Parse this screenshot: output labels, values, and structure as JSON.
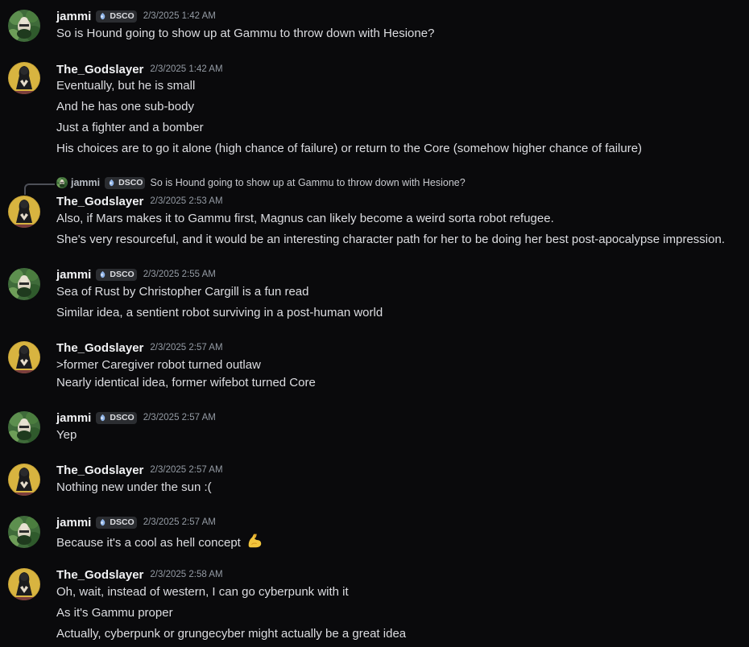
{
  "colors": {
    "background": "#0a0a0c",
    "text": "#dcdde1",
    "username": "#f2f3f5",
    "timestamp": "#949ba4",
    "tag_bg": "#2b2d31"
  },
  "messages": [
    {
      "user": "jammi",
      "avatar": "jammi-avatar",
      "tag": "DSCO",
      "timestamp": "2/3/2025 1:42 AM",
      "lines": [
        "So is Hound going to show up at Gammu to throw down with Hesione?"
      ]
    },
    {
      "user": "The_Godslayer",
      "avatar": "godslayer-avatar",
      "timestamp": "2/3/2025 1:42 AM",
      "lines": [
        "Eventually, but he is small",
        "And he has one sub-body",
        "Just a fighter and a bomber",
        "His choices are to go it alone (high chance of failure) or return to the Core (somehow higher chance of failure)"
      ]
    },
    {
      "user": "The_Godslayer",
      "avatar": "godslayer-avatar",
      "timestamp": "2/3/2025 2:53 AM",
      "reply": {
        "user": "jammi",
        "tag": "DSCO",
        "text": "So is Hound going to show up at Gammu to throw down with Hesione?"
      },
      "lines": [
        "Also, if Mars makes it to Gammu first, Magnus can likely become a weird sorta robot refugee.",
        "She's very resourceful, and it would be an interesting character path for her to be doing her best post-apocalypse impression."
      ]
    },
    {
      "user": "jammi",
      "avatar": "jammi-avatar",
      "tag": "DSCO",
      "timestamp": "2/3/2025 2:55 AM",
      "lines": [
        "Sea of Rust by Christopher Cargill is a fun read",
        "Similar idea, a sentient robot surviving in a post-human world"
      ]
    },
    {
      "user": "The_Godslayer",
      "avatar": "godslayer-avatar",
      "timestamp": "2/3/2025 2:57 AM",
      "lines": [
        ">former Caregiver robot turned outlaw",
        "Nearly identical idea, former wifebot turned Core"
      ]
    },
    {
      "user": "jammi",
      "avatar": "jammi-avatar",
      "tag": "DSCO",
      "timestamp": "2/3/2025 2:57 AM",
      "lines": [
        "Yep"
      ]
    },
    {
      "user": "The_Godslayer",
      "avatar": "godslayer-avatar",
      "timestamp": "2/3/2025 2:57 AM",
      "lines": [
        "Nothing new under the sun :("
      ]
    },
    {
      "user": "jammi",
      "avatar": "jammi-avatar",
      "tag": "DSCO",
      "timestamp": "2/3/2025 2:57 AM",
      "lines": [
        "Because it's a cool as hell concept"
      ],
      "emoji": "flexed-biceps-emoji"
    },
    {
      "user": "The_Godslayer",
      "avatar": "godslayer-avatar",
      "timestamp": "2/3/2025 2:58 AM",
      "lines": [
        "Oh, wait, instead of western, I can go cyberpunk with it",
        "As it's Gammu proper",
        "Actually, cyberpunk or grungecyber might actually be a great idea"
      ]
    }
  ]
}
